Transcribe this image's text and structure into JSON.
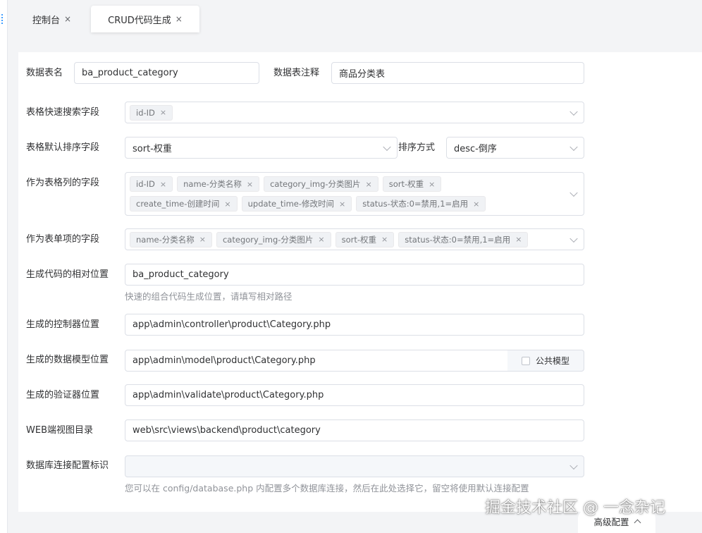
{
  "tabs": [
    {
      "label": "控制台"
    },
    {
      "label": "CRUD代码生成"
    }
  ],
  "close_glyph": "×",
  "form": {
    "table_name": {
      "label": "数据表名",
      "value": "ba_product_category"
    },
    "table_comment": {
      "label": "数据表注释",
      "value": "商品分类表"
    },
    "quick_search": {
      "label": "表格快速搜索字段",
      "tags": [
        "id-ID"
      ]
    },
    "default_sort": {
      "label": "表格默认排序字段",
      "value": "sort-权重"
    },
    "sort_order": {
      "label": "排序方式",
      "value": "desc-倒序"
    },
    "table_columns": {
      "label": "作为表格列的字段",
      "tags": [
        "id-ID",
        "name-分类名称",
        "category_img-分类图片",
        "sort-权重",
        "create_time-创建时间",
        "update_time-修改时间",
        "status-状态:0=禁用,1=启用"
      ]
    },
    "form_fields": {
      "label": "作为表单项的字段",
      "tags": [
        "name-分类名称",
        "category_img-分类图片",
        "sort-权重",
        "status-状态:0=禁用,1=启用"
      ]
    },
    "relative_path": {
      "label": "生成代码的相对位置",
      "value": "ba_product_category",
      "hint": "快速的组合代码生成位置，请填写相对路径"
    },
    "controller_path": {
      "label": "生成的控制器位置",
      "value": "app\\admin\\controller\\product\\Category.php"
    },
    "model_path": {
      "label": "生成的数据模型位置",
      "value": "app\\admin\\model\\product\\Category.php",
      "common_model_label": "公共模型"
    },
    "validate_path": {
      "label": "生成的验证器位置",
      "value": "app\\admin\\validate\\product\\Category.php"
    },
    "web_view_dir": {
      "label": "WEB端视图目录",
      "value": "web\\src\\views\\backend\\product\\category"
    },
    "db_connection": {
      "label": "数据库连接配置标识",
      "value": "",
      "hint": "您可以在 config/database.php 内配置多个数据库连接，然后在此处选择它，留空将使用默认连接配置"
    }
  },
  "advanced": {
    "label": "高级配置"
  },
  "watermark": "掘金技术社区 @ 一念杂记",
  "colors": {
    "tag_bg": "#f0f2f5",
    "border": "#dcdfe6",
    "hint": "#909399",
    "accent": "#409eff"
  }
}
